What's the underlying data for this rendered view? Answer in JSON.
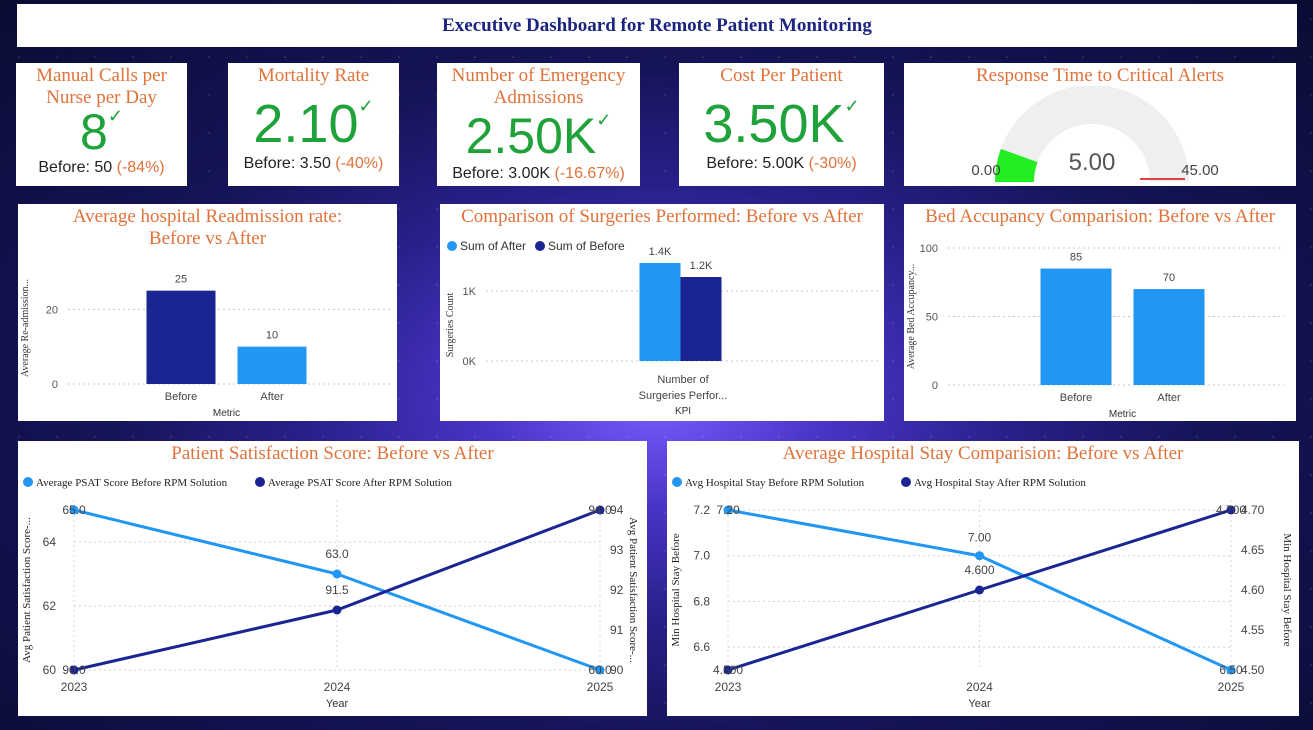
{
  "dashboard": {
    "title": "Executive Dashboard for Remote Patient Monitoring"
  },
  "kpis": [
    {
      "title": "Manual Calls per Nurse per Day",
      "value": "8",
      "before_label": "Before: 50",
      "change": "(-84%)"
    },
    {
      "title": "Mortality Rate",
      "value": "2.10",
      "before_label": "Before: 3.50",
      "change": "(-40%)"
    },
    {
      "title": "Number of Emergency Admissions",
      "value": "2.50K",
      "before_label": "Before: 3.00K",
      "change": "(-16.67%)"
    },
    {
      "title": "Cost Per Patient",
      "value": "3.50K",
      "before_label": "Before: 5.00K",
      "change": "(-30%)"
    }
  ],
  "gauge": {
    "title": "Response Time to Critical Alerts",
    "value": 5.0,
    "value_label": "5.00",
    "min": 0,
    "min_label": "0.00",
    "max": 45,
    "max_label": "45.00",
    "color": "#22ee22"
  },
  "colors": {
    "light": "#2196f3",
    "dark": "#1a2593",
    "accent": "#e0723a",
    "good": "#1fa23a"
  },
  "chart_data": [
    {
      "type": "bar",
      "title": "Average hospital Readmission rate: Before vs After",
      "xlabel": "Metric",
      "ylabel": "Average Re-admission...",
      "categories": [
        "Before",
        "After"
      ],
      "values": [
        25,
        10
      ],
      "value_labels": [
        "25",
        "10"
      ],
      "ylim": [
        0,
        30
      ],
      "yticks": [
        0,
        20
      ],
      "bar_colors": [
        "#1a2593",
        "#2196f3"
      ]
    },
    {
      "type": "bar",
      "title": "Comparison of Surgeries Performed: Before vs After",
      "xlabel": "KPI",
      "ylabel": "Surgeries Count",
      "categories": [
        "Number of Surgeries Perfor..."
      ],
      "category_lines": [
        "Number of",
        "Surgeries Perfor..."
      ],
      "series": [
        {
          "name": "Sum of After",
          "values": [
            1400
          ],
          "label": "1.4K",
          "color": "#2196f3"
        },
        {
          "name": "Sum of Before",
          "values": [
            1200
          ],
          "label": "1.2K",
          "color": "#1a2593"
        }
      ],
      "ylim": [
        0,
        1600
      ],
      "yticks": [
        0,
        1000
      ],
      "ytick_labels": [
        "0K",
        "1K"
      ]
    },
    {
      "type": "bar",
      "title": "Bed Accupancy Comparision: Before vs After",
      "xlabel": "Metric",
      "ylabel": "Average Bed Accupancy...",
      "categories": [
        "Before",
        "After"
      ],
      "values": [
        85,
        70
      ],
      "value_labels": [
        "85",
        "70"
      ],
      "ylim": [
        0,
        100
      ],
      "yticks": [
        0,
        50,
        100
      ],
      "bar_colors": [
        "#2196f3",
        "#2196f3"
      ]
    },
    {
      "type": "line",
      "title": "Patient Satisfaction Score: Before vs After",
      "xlabel": "Year",
      "ylabel": "Avg Patient Satisfaction Score-...",
      "y2label": "Avg Patient Satisfaction Score-...",
      "x": [
        "2023",
        "2024",
        "2025"
      ],
      "series": [
        {
          "name": "Average PSAT Score Before RPM Solution",
          "values": [
            65,
            63,
            60
          ],
          "labels": [
            "65.0",
            "63.0",
            "60.0"
          ],
          "axis": "left",
          "color": "#2196f3"
        },
        {
          "name": "Average PSAT Score After RPM Solution",
          "values": [
            90,
            91.5,
            94
          ],
          "labels": [
            "90.0",
            "91.5",
            "94.0"
          ],
          "axis": "right",
          "color": "#1a2593"
        }
      ],
      "ylim": [
        60,
        65
      ],
      "yticks": [
        60,
        62,
        64
      ],
      "y2lim": [
        90,
        94
      ],
      "y2ticks": [
        90,
        91,
        92,
        93,
        94
      ]
    },
    {
      "type": "line",
      "title": "Average Hospital Stay Comparision: Before vs After",
      "xlabel": "Year",
      "ylabel": "Min Hospital Stay Before",
      "y2label": "Min Hospital Stay Before",
      "x": [
        "2023",
        "2024",
        "2025"
      ],
      "series": [
        {
          "name": "Avg Hospital Stay Before RPM Solution",
          "values": [
            7.2,
            7.0,
            6.5
          ],
          "labels": [
            "7.20",
            "7.00",
            "6.50"
          ],
          "axis": "left",
          "color": "#2196f3"
        },
        {
          "name": "Avg Hospital Stay After RPM Solution",
          "values": [
            4.5,
            4.6,
            4.7
          ],
          "labels": [
            "4.500",
            "4.600",
            "4.700"
          ],
          "axis": "right",
          "color": "#1a2593"
        }
      ],
      "ylim": [
        6.5,
        7.2
      ],
      "yticks": [
        6.6,
        6.8,
        7.0,
        7.2
      ],
      "ytick_labels": [
        "6.6",
        "6.8",
        "7.0",
        "7.2"
      ],
      "y2lim": [
        4.5,
        4.7
      ],
      "y2ticks": [
        4.5,
        4.55,
        4.6,
        4.65,
        4.7
      ],
      "y2tick_labels": [
        "4.50",
        "4.55",
        "4.60",
        "4.65",
        "4.70"
      ]
    }
  ]
}
